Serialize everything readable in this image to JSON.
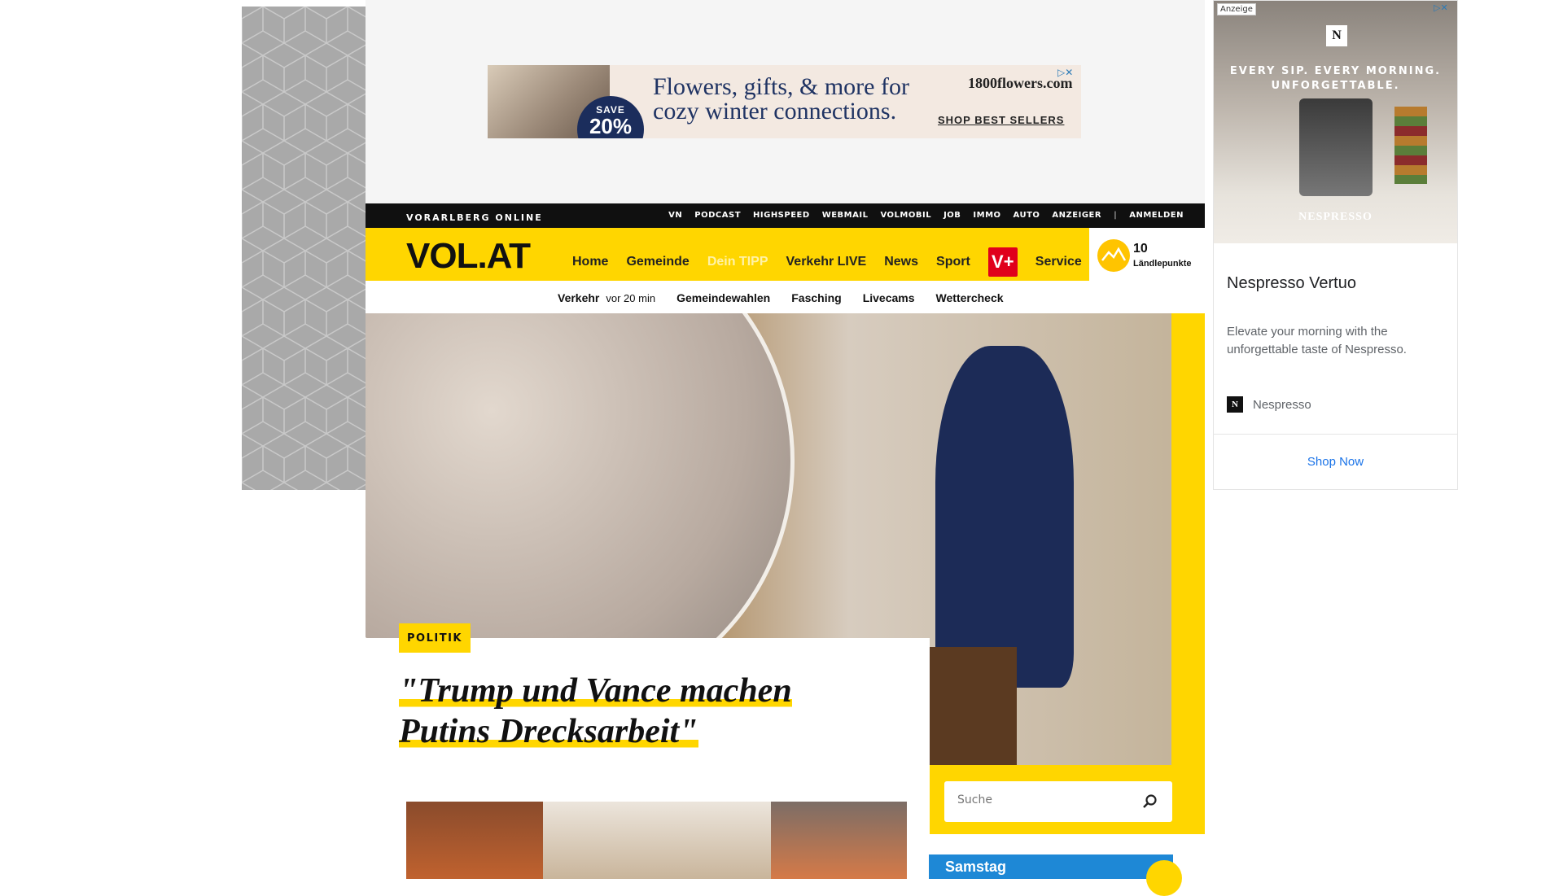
{
  "leaderboard_ad": {
    "save_line1": "SAVE",
    "save_line2": "20%",
    "headline": "Flowers, gifts, & more for cozy winter connections.",
    "brand": "1800flowers.com",
    "cta": "SHOP BEST SELLERS",
    "adchoices": "▷✕"
  },
  "topbar": {
    "brand": "VORARLBERG ONLINE",
    "links": [
      "VN",
      "PODCAST",
      "HIGHSPEED",
      "WEBMAIL",
      "VOLMOBIL",
      "JOB",
      "IMMO",
      "AUTO",
      "ANZEIGER",
      "|",
      "ANMELDEN"
    ]
  },
  "header": {
    "logo": "VOL.AT",
    "nav": [
      "Home",
      "Gemeinde",
      "Dein TIPP",
      "Verkehr LIVE",
      "News",
      "Sport"
    ],
    "vplus": "V+",
    "service": "Service",
    "points_value": "10",
    "points_label": "Ländlepunkte"
  },
  "subnav": {
    "verkehr": "Verkehr",
    "verkehr_time": "vor 20 min",
    "items": [
      "Gemeindewahlen",
      "Fasching",
      "Livecams",
      "Wettercheck"
    ]
  },
  "hero": {
    "category": "POLITIK",
    "headline_line1": "\"Trump und Vance machen",
    "headline_line2": "Putins Drecksarbeit\""
  },
  "search": {
    "placeholder": "Suche"
  },
  "weather": {
    "day": "Samstag"
  },
  "right_ad": {
    "label": "Anzeige",
    "close": "▷✕",
    "logo_letter": "N",
    "tagline_line1": "EVERY SIP. EVERY MORNING.",
    "tagline_line2": "UNFORGETTABLE.",
    "brand_on_image": "NESPRESSO",
    "title": "Nespresso Vertuo",
    "description": "Elevate your morning with the unforgettable taste of Nespresso.",
    "advertiser": "Nespresso",
    "cta": "Shop Now"
  },
  "colors": {
    "brand_yellow": "#ffd600",
    "topbar_black": "#101010",
    "vplus_red": "#e0001b",
    "weather_blue": "#1e88d6"
  }
}
